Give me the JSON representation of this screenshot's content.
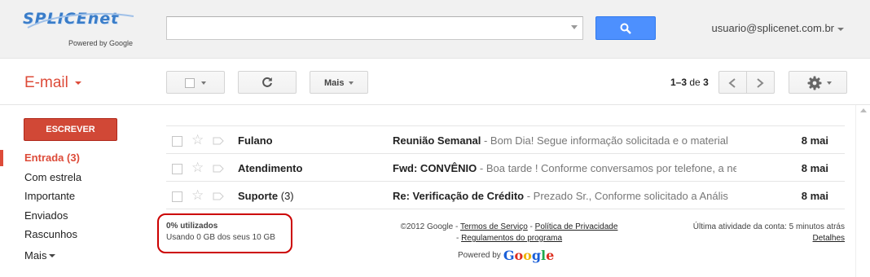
{
  "header": {
    "logo_text": "SPLICEnet",
    "logo_sub": "Powered by Google",
    "search_value": "",
    "account_email": "usuario@splicenet.com.br"
  },
  "toolbar": {
    "app_title": "E-mail",
    "more_label": "Mais",
    "pager_range": "1–3",
    "pager_of": "de",
    "pager_total": "3"
  },
  "sidebar": {
    "compose_label": "ESCREVER",
    "items": [
      {
        "label": "Entrada (3)"
      },
      {
        "label": "Com estrela"
      },
      {
        "label": "Importante"
      },
      {
        "label": "Enviados"
      },
      {
        "label": "Rascunhos"
      }
    ],
    "more_label": "Mais"
  },
  "emails": [
    {
      "sender": "Fulano",
      "count": "",
      "subject": "Reunião Semanal",
      "snippet": " - Bom Dia! Segue informação solicitada e o material",
      "date": "8 mai"
    },
    {
      "sender": "Atendimento",
      "count": "",
      "subject": "Fwd: CONVÊNIO",
      "snippet": " - Boa tarde ! Conforme conversamos por telefone, a ne",
      "date": "8 mai"
    },
    {
      "sender": "Suporte",
      "count": " (3)",
      "subject": "Re: Verificação de Crédito",
      "snippet": " - Prezado Sr., Conforme solicitado a Anális",
      "date": "8 mai"
    }
  ],
  "footer": {
    "storage_percent": "0% utilizados",
    "storage_detail": "Usando 0 GB dos seus 10 GB",
    "copyright": "©2012 Google - ",
    "terms": "Termos de Serviço",
    "sep1": " - ",
    "privacy": "Política de Privacidade",
    "sep2": " - ",
    "program_rules": "Regulamentos do programa",
    "powered_by": "Powered by",
    "google": "Google",
    "last_activity": "Última atividade da conta: 5 minutos atrás",
    "details": "Detalhes"
  },
  "colors": {
    "accent_red": "#dd4b39",
    "compose_red": "#d14836",
    "search_blue": "#4d90fe",
    "highlight_circle": "#cc0000"
  },
  "icons": [
    "search-icon",
    "refresh-icon",
    "chevron-left-icon",
    "chevron-right-icon",
    "gear-icon",
    "star-icon",
    "importance-marker-icon"
  ]
}
